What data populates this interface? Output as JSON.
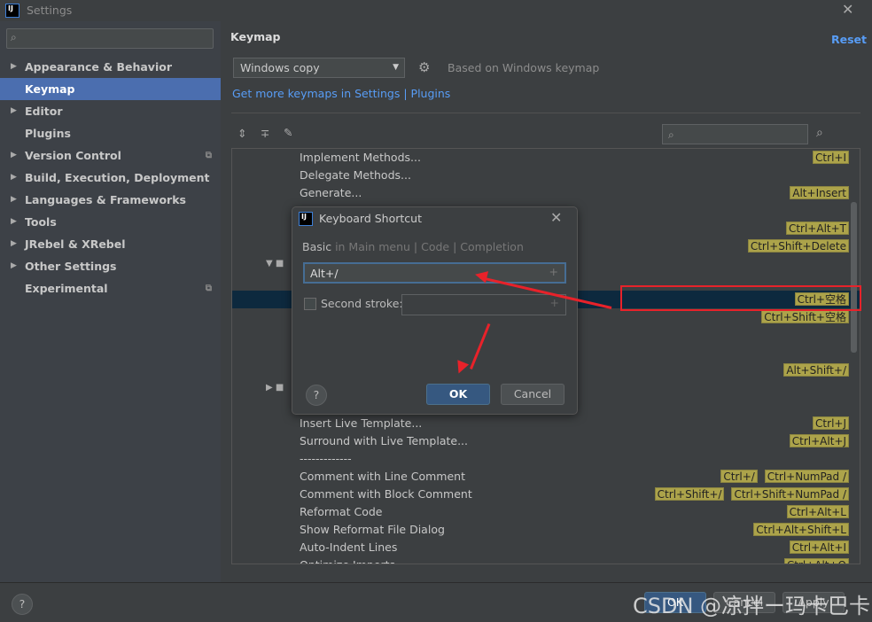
{
  "window": {
    "title": "Settings"
  },
  "sidebar": {
    "search_placeholder": "",
    "items": [
      {
        "label": "Appearance & Behavior",
        "expandable": true
      },
      {
        "label": "Keymap",
        "selected": true
      },
      {
        "label": "Editor",
        "expandable": true
      },
      {
        "label": "Plugins"
      },
      {
        "label": "Version Control",
        "expandable": true,
        "project": true
      },
      {
        "label": "Build, Execution, Deployment",
        "expandable": true
      },
      {
        "label": "Languages & Frameworks",
        "expandable": true
      },
      {
        "label": "Tools",
        "expandable": true
      },
      {
        "label": "JRebel & XRebel",
        "expandable": true
      },
      {
        "label": "Other Settings",
        "expandable": true
      },
      {
        "label": "Experimental",
        "project": true
      }
    ]
  },
  "main": {
    "title": "Keymap",
    "reset": "Reset",
    "keymap_select": "Windows copy",
    "based_on": "Based on Windows keymap",
    "get_more": "Get more keymaps in Settings | Plugins",
    "rows": [
      {
        "label": "Implement Methods...",
        "keys": [
          "Ctrl+I"
        ]
      },
      {
        "label": "Delegate Methods...",
        "keys": []
      },
      {
        "label": "Generate...",
        "keys": [
          "Alt+Insert"
        ]
      },
      {
        "label": "",
        "keys": []
      },
      {
        "label": "",
        "keys": [
          "Ctrl+Alt+T"
        ]
      },
      {
        "label": "",
        "keys": [
          "Ctrl+Shift+Delete"
        ]
      },
      {
        "label": "",
        "keys": [],
        "folder": "expanded"
      },
      {
        "label": "",
        "keys": []
      },
      {
        "label": "",
        "keys": [
          "Ctrl+空格"
        ],
        "selected": true
      },
      {
        "label": "",
        "keys": [
          "Ctrl+Shift+空格"
        ]
      },
      {
        "label": "",
        "keys": []
      },
      {
        "label": "",
        "keys": []
      },
      {
        "label": "",
        "keys": [
          "Alt+Shift+/"
        ]
      },
      {
        "label": "",
        "keys": [],
        "folder": "collapsed"
      },
      {
        "label": "",
        "keys": []
      },
      {
        "label": "Insert Live Template...",
        "keys": [
          "Ctrl+J"
        ]
      },
      {
        "label": "Surround with Live Template...",
        "keys": [
          "Ctrl+Alt+J"
        ]
      },
      {
        "label": "-------------",
        "keys": []
      },
      {
        "label": "Comment with Line Comment",
        "keys": [
          "Ctrl+/",
          "Ctrl+NumPad /"
        ]
      },
      {
        "label": "Comment with Block Comment",
        "keys": [
          "Ctrl+Shift+/",
          "Ctrl+Shift+NumPad /"
        ]
      },
      {
        "label": "Reformat Code",
        "keys": [
          "Ctrl+Alt+L"
        ]
      },
      {
        "label": "Show Reformat File Dialog",
        "keys": [
          "Ctrl+Alt+Shift+L"
        ]
      },
      {
        "label": "Auto-Indent Lines",
        "keys": [
          "Ctrl+Alt+I"
        ]
      },
      {
        "label": "Optimize Imports",
        "keys": [
          "Ctrl+Alt+O"
        ]
      }
    ]
  },
  "dialog": {
    "title": "Keyboard Shortcut",
    "path_bold": "Basic",
    "path_rest": " in Main menu | Code | Completion",
    "first_stroke": "Alt+/",
    "second_stroke_label": "Second stroke:",
    "second_stroke_value": "",
    "ok": "OK",
    "cancel": "Cancel",
    "help": "?"
  },
  "bottom": {
    "help": "?",
    "ok": "OK",
    "cancel": "Cancel",
    "apply": "Apply"
  },
  "watermark": "CSDN @凉拌ー玛卡巴卡",
  "colors": {
    "accent": "#4b6eaf",
    "annotation": "#e8222a",
    "shortcut_badge": "#aca34a"
  }
}
